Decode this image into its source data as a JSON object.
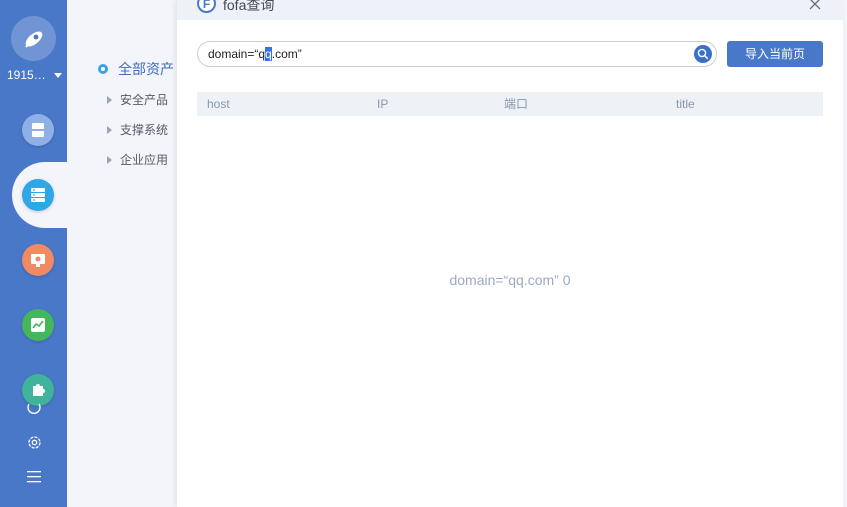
{
  "rail": {
    "user_label": "1915…",
    "icons": [
      {
        "name": "scanner-icon",
        "color": "#8fb0e6"
      },
      {
        "name": "server-icon",
        "color": "#2fa6e8"
      },
      {
        "name": "vulnerability-icon",
        "color": "#f08a63"
      },
      {
        "name": "chart-icon",
        "color": "#45b65b"
      },
      {
        "name": "plugin-icon",
        "color": "#3fb49a"
      }
    ]
  },
  "tree": {
    "root_label": "全部资产",
    "items": [
      {
        "label": "安全产品"
      },
      {
        "label": "支撑系统"
      },
      {
        "label": "企业应用"
      }
    ]
  },
  "dialog": {
    "title": "fofa查询",
    "logo_letter": "F",
    "search": {
      "before": "domain=“q",
      "selected": "q",
      "after": ".com”"
    },
    "import_label": "导入当前页",
    "columns": [
      "host",
      "IP",
      "端口",
      "title"
    ],
    "empty_message": "domain=“qq.com” 0"
  },
  "colors": {
    "accent": "#4a78c8",
    "rail_bg": "#4a78c8"
  }
}
